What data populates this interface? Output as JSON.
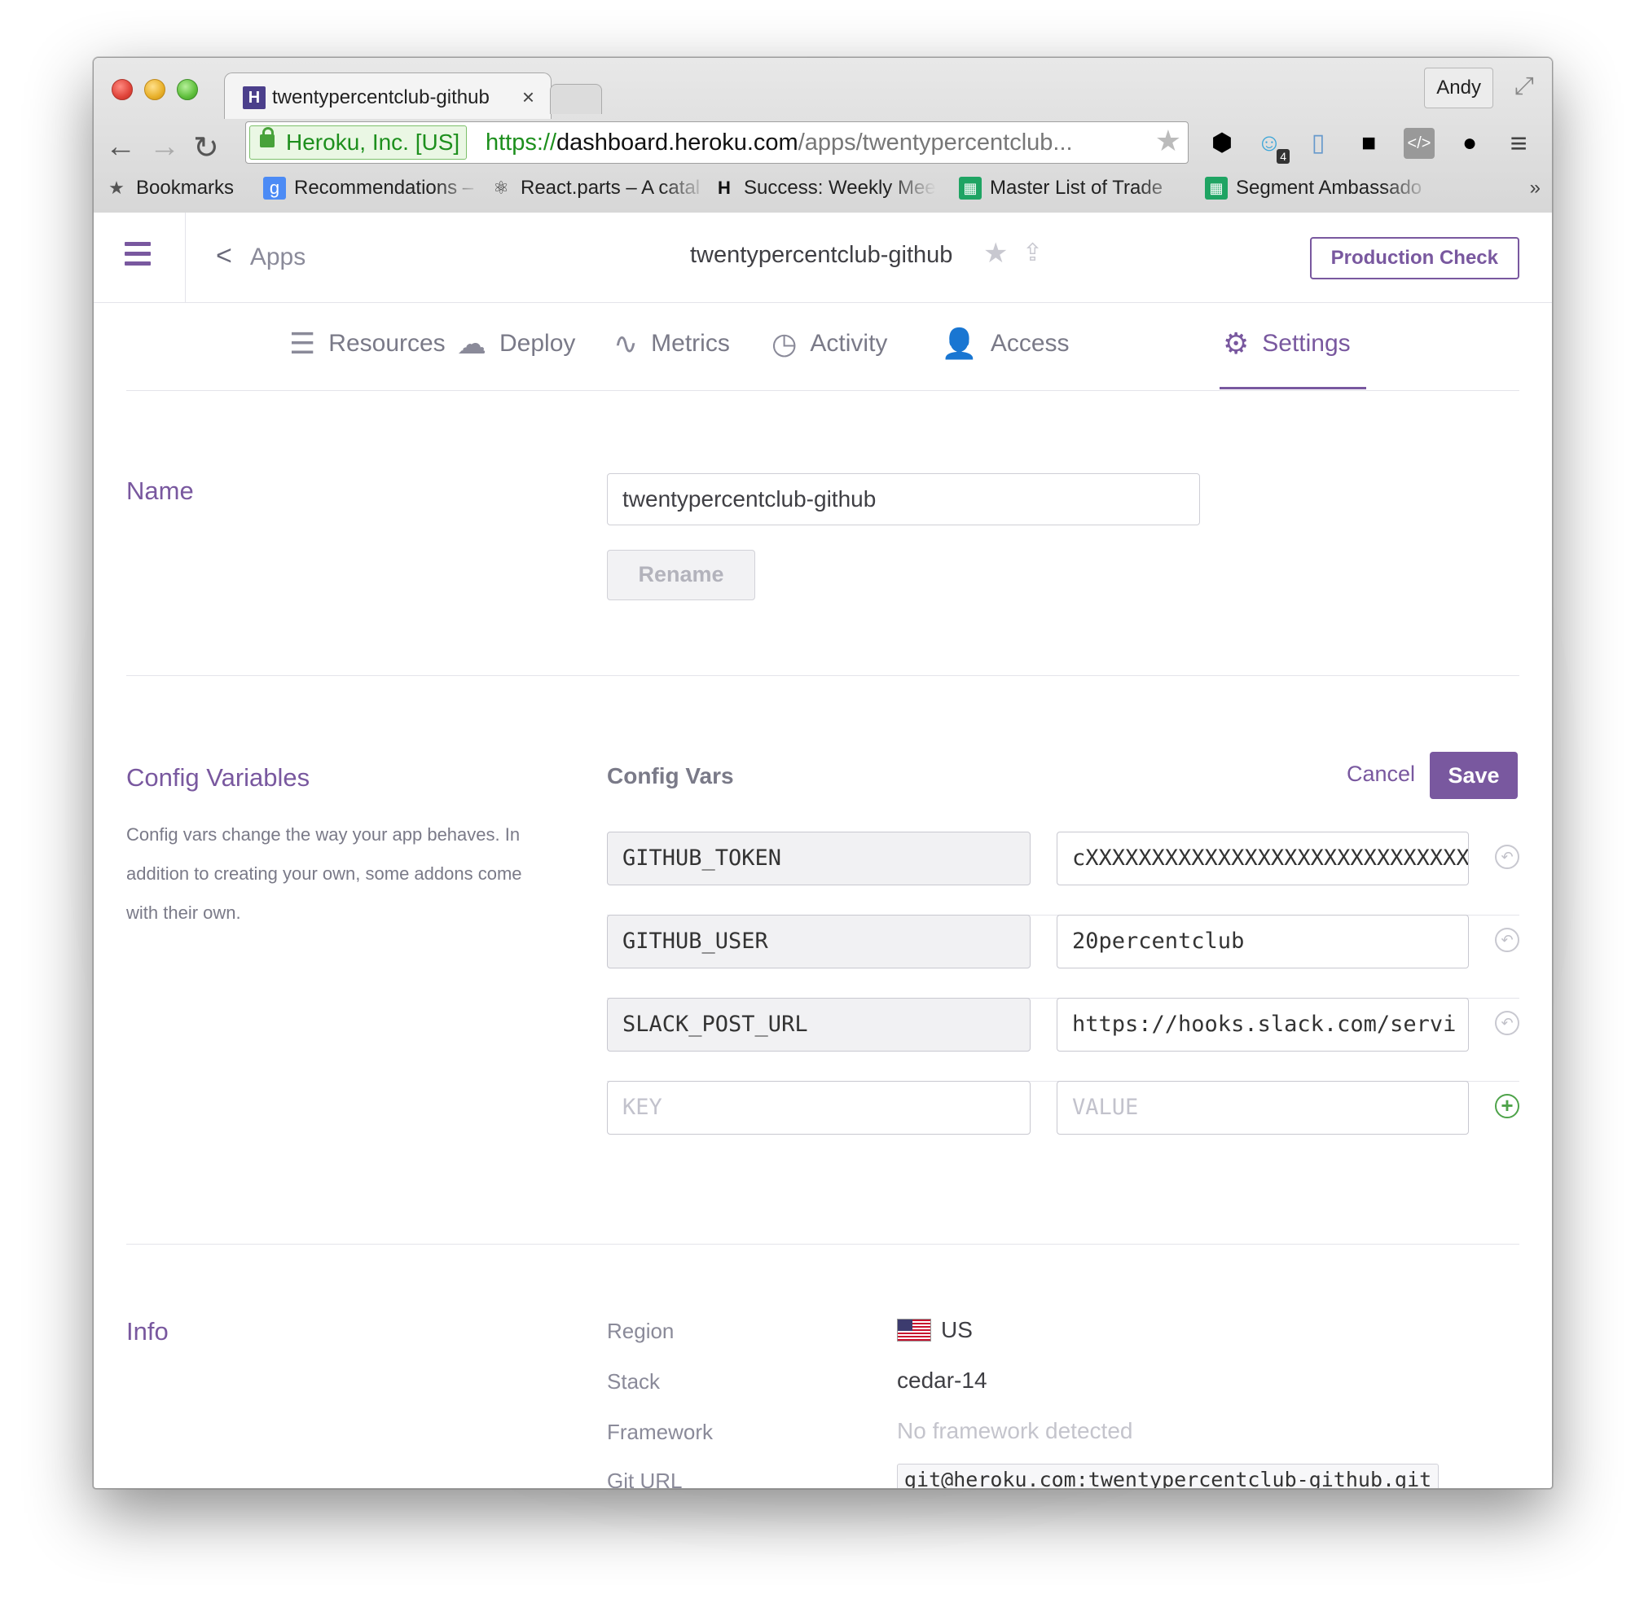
{
  "browser": {
    "tab_title": "twentypercentclub-github",
    "tab_favicon": "H",
    "close_glyph": "×",
    "profile": "Andy",
    "ev_label": "Heroku, Inc. [US]",
    "url_scheme": "https://",
    "url_host": "dashboard.heroku.com",
    "url_path": "/apps/twentypercentclub...",
    "ext_badge": "4",
    "bookmarks": [
      {
        "label": "Bookmarks",
        "icon": "star-icon"
      },
      {
        "label": "Recommendations –",
        "icon": "google-icon"
      },
      {
        "label": "React.parts – A catal",
        "icon": "react-icon"
      },
      {
        "label": "Success: Weekly Mee",
        "icon": "h-icon"
      },
      {
        "label": "Master List of Trade",
        "icon": "sheets-icon"
      },
      {
        "label": "Segment Ambassado",
        "icon": "sheets-icon"
      }
    ],
    "more_glyph": "»"
  },
  "header": {
    "back_label": "Apps",
    "app_name": "twentypercentclub-github",
    "production_check": "Production Check"
  },
  "tabs": [
    {
      "label": "Resources",
      "icon": "sliders-icon"
    },
    {
      "label": "Deploy",
      "icon": "cloud-upload-icon"
    },
    {
      "label": "Metrics",
      "icon": "pulse-icon"
    },
    {
      "label": "Activity",
      "icon": "clock-icon"
    },
    {
      "label": "Access",
      "icon": "user-lock-icon"
    },
    {
      "label": "Settings",
      "icon": "gears-icon",
      "active": true
    }
  ],
  "name_section": {
    "title": "Name",
    "value": "twentypercentclub-github",
    "rename_label": "Rename"
  },
  "config_section": {
    "title": "Config Variables",
    "description": "Config vars change the way your app behaves. In addition to creating your own, some addons come with their own.",
    "heading": "Config Vars",
    "cancel_label": "Cancel",
    "save_label": "Save",
    "vars": [
      {
        "key": "GITHUB_TOKEN",
        "value": "cXXXXXXXXXXXXXXXXXXXXXXXXXXXXXX"
      },
      {
        "key": "GITHUB_USER",
        "value": "20percentclub"
      },
      {
        "key": "SLACK_POST_URL",
        "value": "https://hooks.slack.com/servi"
      }
    ],
    "new_key_placeholder": "KEY",
    "new_value_placeholder": "VALUE"
  },
  "info_section": {
    "title": "Info",
    "region_label": "Region",
    "region_value": "US",
    "stack_label": "Stack",
    "stack_value": "cedar-14",
    "framework_label": "Framework",
    "framework_value": "No framework detected",
    "git_url_label": "Git URL",
    "git_url_value": "git@heroku.com:twentypercentclub-github.git"
  },
  "colors": {
    "accent": "#79589f",
    "add_green": "#4ea34a"
  }
}
